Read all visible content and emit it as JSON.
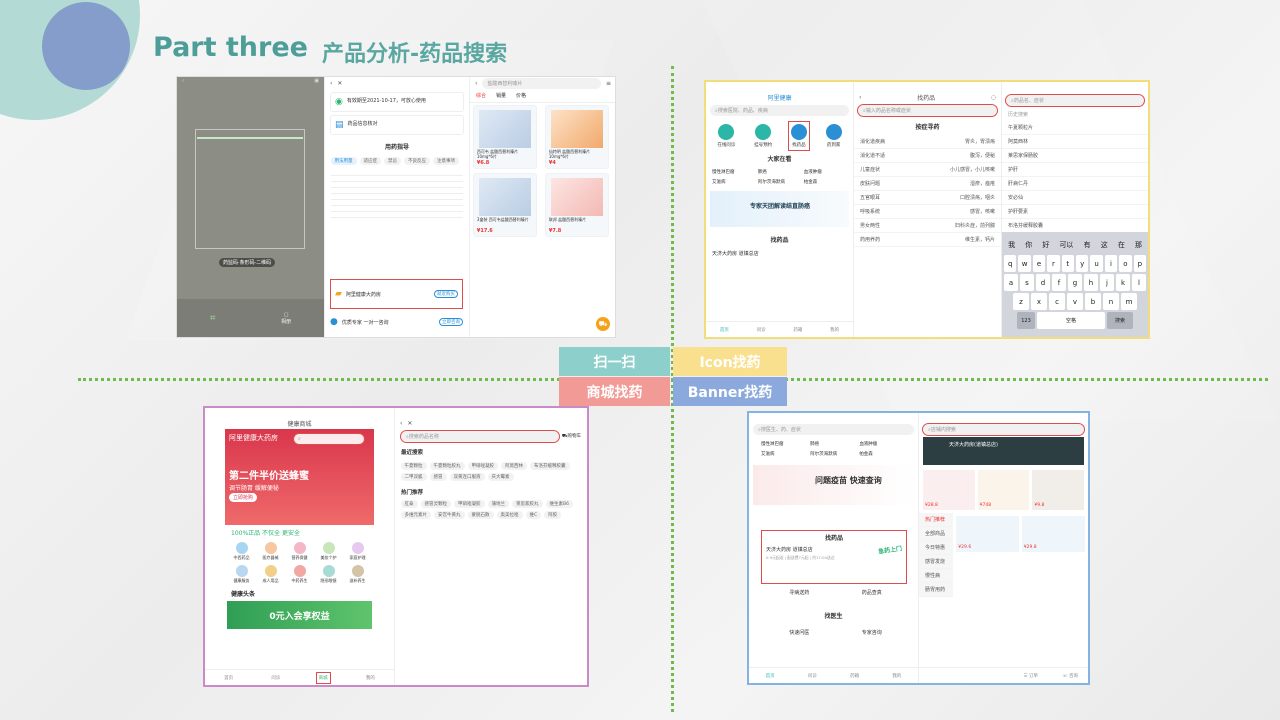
{
  "slide": {
    "title_en": "Part three",
    "title_cn": "产品分析-药品搜索",
    "accent": "#4d9e99"
  },
  "legend": {
    "scan": "扫一扫",
    "icon": "Icon找药",
    "mall": "商城找药",
    "banner": "Banner找药",
    "colors": {
      "scan": "#8ccfcb",
      "icon": "#f9e08e",
      "mall": "#f29a96",
      "banner": "#8ba9dc"
    }
  },
  "scan_quad": {
    "p1": {
      "scan_label": "药监码·条形码·二维码",
      "album": "相册"
    },
    "p2": {
      "items": [
        "有效期至2021-10-17，可放心使用",
        "药品信息核对"
      ],
      "guide_title": "用药指导",
      "guide_tabs": [
        "用法用量",
        "适应症",
        "禁忌",
        "不良反应",
        "注意事项"
      ],
      "banner_title": "阿里健康大药房",
      "banner_btn": "就近购买",
      "expert_title": "优质专家 一对一咨询",
      "expert_btn": "立即咨询"
    },
    "p3": {
      "search_value": "盐酸西替利嗪片",
      "tabs": [
        "综合",
        "销量",
        "价格"
      ],
      "products": [
        {
          "name": "西可韦 盐酸西替利嗪片 10mg*6片",
          "price": "¥6.8"
        },
        {
          "name": "仙特明 盐酸西替利嗪片 10mg*6片",
          "price": "¥4"
        },
        {
          "name": "3盒装 西可韦盐酸西替利嗪片",
          "price": "¥17.6"
        },
        {
          "name": "联邦 盐酸西替利嗪片",
          "price": "¥7.8"
        }
      ]
    }
  },
  "icon_quad": {
    "p1": {
      "app_title": "阿里健康",
      "search_placeholder": "搜索医院、药品、疾病",
      "icons": [
        "在线问诊",
        "挂号预约",
        "找药品",
        "药到家"
      ],
      "section_see": "大家在看",
      "see_items": [
        "慢性淋巴瘤",
        "肺癌",
        "血液肿瘤",
        "艾滋病",
        "阿尔茨海默病",
        "帕金森"
      ],
      "banner_text": "专家天团解读结直肠癌",
      "section_pharmacy": "找药品",
      "pharmacy_name": "天济大药房 道镇总店",
      "tabs": [
        "首页",
        "问诊",
        "药箱",
        "我的"
      ]
    },
    "p2": {
      "title": "找药品",
      "search_placeholder": "输入药品名称或症状",
      "section": "按症寻药",
      "rows": [
        {
          "name": "消化道疾病",
          "desc": "胃炎，胃溃疡"
        },
        {
          "name": "消化道不适",
          "desc": "腹泻，便秘"
        },
        {
          "name": "儿童症状",
          "desc": "小儿感冒，小儿咳嗽"
        },
        {
          "name": "皮肤问题",
          "desc": "湿疹，痤疮"
        },
        {
          "name": "五官眼耳",
          "desc": "口腔溃疡，咽炎"
        },
        {
          "name": "呼吸系统",
          "desc": "感冒，咳嗽"
        },
        {
          "name": "男女两性",
          "desc": "妇科炎症，前列腺"
        },
        {
          "name": "药用养药",
          "desc": "维生素，钙片"
        }
      ]
    },
    "p3": {
      "search_placeholder": "药品名、症状",
      "history_title": "历史搜索",
      "history": [
        "午夏颗粒片",
        "阿莫西林",
        "莱思家保肠胶",
        "护肝",
        "肝病仁丹",
        "安必仙",
        "护肝要素",
        "布洛芬缓释胶囊"
      ],
      "suggest": [
        "我",
        "你",
        "好",
        "可以",
        "有",
        "这",
        "在",
        "那"
      ],
      "kb_rows": [
        [
          "q",
          "w",
          "e",
          "r",
          "t",
          "y",
          "u",
          "i",
          "o",
          "p"
        ],
        [
          "a",
          "s",
          "d",
          "f",
          "g",
          "h",
          "j",
          "k",
          "l"
        ],
        [
          "z",
          "x",
          "c",
          "v",
          "b",
          "n",
          "m"
        ]
      ],
      "space": "空格",
      "num": "123",
      "search": "搜索"
    }
  },
  "mall_quad": {
    "p1": {
      "title": "健康商城",
      "store": "阿里健康大药房",
      "promo_big": "第二件半价送蜂蜜",
      "promo_sub": "调节肠胃 缓解便秘",
      "promo_btn": "立即抢购",
      "slogan": "100%正品 不仅全 更安全",
      "categories": [
        "中西药品",
        "医疗器械",
        "营养保健",
        "美妆个护",
        "家庭护理",
        "健康服务",
        "成人用品",
        "中药养生",
        "隐形眼镜",
        "滋补养生"
      ],
      "news_label": "健康头条",
      "vip_text": "0元入会享权益",
      "tabs": [
        "首页",
        "问诊",
        "商城",
        "我的"
      ]
    },
    "p2": {
      "search_placeholder": "搜索药品名称",
      "cart": "购物车",
      "history_title": "最近搜索",
      "history": [
        "午夏颗粒",
        "午夏颗粒胶丸",
        "甲硝唑凝胶",
        "阿莫西林",
        "布洛芬缓释胶囊",
        "二甲双胍",
        "感冒",
        "双黄连口服液",
        "庆大霉素"
      ],
      "hot_title": "热门推荐",
      "hot": [
        "肛泰",
        "感冒灵颗粒",
        "甲硝唑凝胶",
        "蒲地兰",
        "莱思家胶丸",
        "维生素B6",
        "多维元素片",
        "安宫牛黄丸",
        "蒙脱石散",
        "奥美拉唑",
        "维C",
        "阿胶"
      ]
    }
  },
  "banner_quad": {
    "p1": {
      "search_placeholder": "搜医生、药、症状",
      "see_items": [
        "慢性淋巴瘤",
        "肺癌",
        "血液肿瘤",
        "艾滋病",
        "阿尔茨海默病",
        "帕金森"
      ],
      "banner_text": "问题疫苗 快速查询",
      "section_pharmacy": "找药品",
      "pharmacy_name": "天济大药房 道镇总店",
      "pharmacy_sub": "0.9元起送 | 配送费7元起 | 约17:04送达",
      "delivery_badge": "急药上门",
      "links": [
        "寻病送药",
        "药品查真"
      ],
      "doctor_section": "找医生",
      "doctor_links": [
        "快速问医",
        "专家咨询"
      ],
      "tabs": [
        "首页",
        "问诊",
        "药箱",
        "我的"
      ]
    },
    "p2": {
      "store_title": "天济大药房(道镇总店)",
      "search_placeholder": "店铺内搜索",
      "side_items": [
        "热门推荐",
        "全部商品",
        "今日特惠",
        "感冒发烧",
        "慢性病",
        "肠胃用药"
      ],
      "prices": [
        "¥28.8",
        "¥748",
        "¥9.8",
        "¥29.6",
        "¥29.8"
      ],
      "order": "订单",
      "consult": "咨询"
    }
  }
}
